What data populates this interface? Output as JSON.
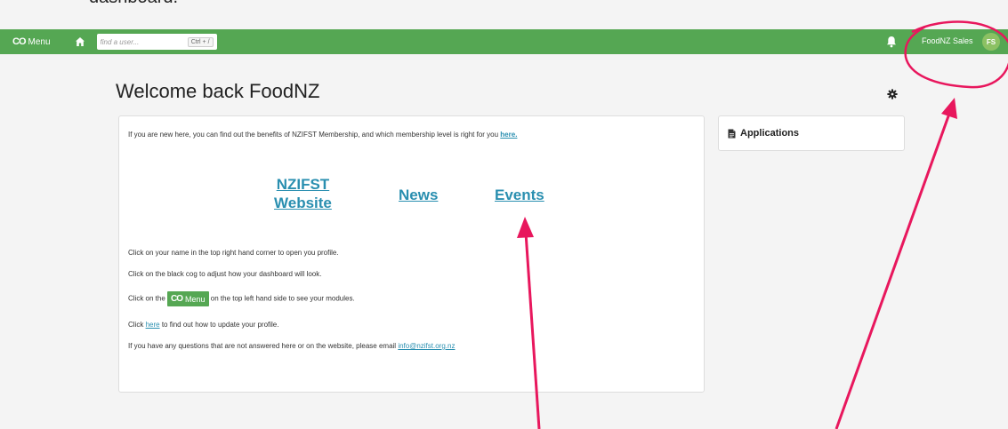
{
  "above_text": "dashboard.",
  "topbar": {
    "menu_label": "Menu",
    "logo_text": "CO",
    "search_placeholder": "find a user...",
    "search_shortcut": "Ctrl + /",
    "user_name": "FoodNZ Sales",
    "avatar_initials": "FS"
  },
  "header": {
    "title": "Welcome back FoodNZ"
  },
  "welcome": {
    "intro_text": "If you are new here, you can find out the benefits of NZIFST Membership, and which membership level is right for you",
    "intro_link": "here.",
    "links": {
      "website_line1": "NZIFST",
      "website_line2": "Website",
      "news": "News",
      "events": "Events"
    },
    "instr1": "Click on your name in the top right hand corner to open you profile.",
    "instr2": "Click on the black cog to adjust how your dashboard will look.",
    "instr3_pre": "Click on the",
    "instr3_post": "on the top left hand side to see your modules.",
    "instr4_pre": "Click",
    "instr4_link": "here",
    "instr4_post": "to find out how to update your profile.",
    "instr5_pre": "If you have any questions that are not answered here or on the website, please email",
    "instr5_email": "info@nzifst.org.nz"
  },
  "applications": {
    "title": "Applications"
  },
  "colors": {
    "brand_green": "#55a753",
    "link_blue": "#2a8fb0",
    "annotation": "#e8175d"
  }
}
